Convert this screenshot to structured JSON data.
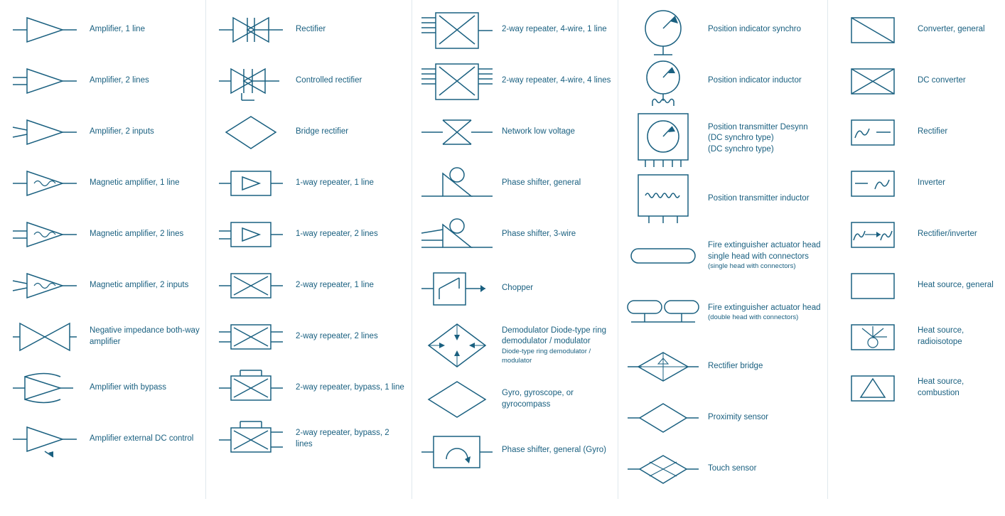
{
  "columns": [
    {
      "items": [
        {
          "label": "Amplifier, 1 line",
          "symbol": "amp1"
        },
        {
          "label": "Amplifier, 2 lines",
          "symbol": "amp2"
        },
        {
          "label": "Amplifier, 2 inputs",
          "symbol": "amp2in"
        },
        {
          "label": "Magnetic amplifier, 1 line",
          "symbol": "magamp1"
        },
        {
          "label": "Magnetic amplifier, 2 lines",
          "symbol": "magamp2"
        },
        {
          "label": "Magnetic amplifier, 2 inputs",
          "symbol": "magamp2in"
        },
        {
          "label": "Negative impedance both-way amplifier",
          "symbol": "negimpamp"
        },
        {
          "label": "Amplifier with bypass",
          "symbol": "ampbypass"
        },
        {
          "label": "Amplifier external DC control",
          "symbol": "ampdc"
        }
      ]
    },
    {
      "items": [
        {
          "label": "Rectifier",
          "symbol": "rect"
        },
        {
          "label": "Controlled rectifier",
          "symbol": "contrect"
        },
        {
          "label": "Bridge rectifier",
          "symbol": "bridgerect"
        },
        {
          "label": "1-way repeater, 1 line",
          "symbol": "rep1w1l"
        },
        {
          "label": "1-way repeater, 2 lines",
          "symbol": "rep1w2l"
        },
        {
          "label": "2-way repeater, 1 line",
          "symbol": "rep2w1l"
        },
        {
          "label": "2-way repeater, 2 lines",
          "symbol": "rep2w2l"
        },
        {
          "label": "2-way repeater, bypass, 1 line",
          "symbol": "rep2wbp1"
        },
        {
          "label": "2-way repeater, bypass, 2 lines",
          "symbol": "rep2wbp2"
        }
      ]
    },
    {
      "items": [
        {
          "label": "2-way repeater, 4-wire, 1 line",
          "symbol": "rep4w1l"
        },
        {
          "label": "2-way repeater, 4-wire, 4 lines",
          "symbol": "rep4w4l"
        },
        {
          "label": "Network low voltage",
          "symbol": "netlv"
        },
        {
          "label": "Phase shifter, general",
          "symbol": "phasegen"
        },
        {
          "label": "Phase shifter, 3-wire",
          "symbol": "phase3w"
        },
        {
          "label": "Chopper",
          "symbol": "chopper"
        },
        {
          "label": "Demodulator\nDiode-type ring demodulator / modulator",
          "symbol": "demod",
          "sublabel": "Diode-type ring demodulator / modulator"
        },
        {
          "label": "Gyro, gyroscope, or gyrocompass",
          "symbol": "gyro"
        },
        {
          "label": "Phase shifter, general (Gyro)",
          "symbol": "phasegyro"
        }
      ]
    },
    {
      "items": [
        {
          "label": "Position indicator synchro",
          "symbol": "posind"
        },
        {
          "label": "Position indicator inductor",
          "symbol": "posindinduct"
        },
        {
          "label": "Position transmitter Desynn (DC synchro type)",
          "symbol": "postransdesynn"
        },
        {
          "label": "Position transmitter inductor",
          "symbol": "postransinduct"
        },
        {
          "label": "Fire extinguisher actuator head\nsingle head with connectors",
          "symbol": "fire1",
          "sublabel": "(single head with connectors)"
        },
        {
          "label": "Fire extinguisher actuator head\ndouble head with connectors",
          "symbol": "fire2",
          "sublabel": "(double head with connectors)"
        },
        {
          "label": "Rectifier bridge",
          "symbol": "rectbridge"
        },
        {
          "label": "Proximity sensor",
          "symbol": "proxsensor"
        },
        {
          "label": "Touch sensor",
          "symbol": "touchsensor"
        }
      ]
    },
    {
      "items": [
        {
          "label": "Converter, general",
          "symbol": "convgen"
        },
        {
          "label": "DC converter",
          "symbol": "dcconv"
        },
        {
          "label": "Rectifier",
          "symbol": "rect2"
        },
        {
          "label": "Inverter",
          "symbol": "inverter"
        },
        {
          "label": "Rectifier/inverter",
          "symbol": "rectinv"
        },
        {
          "label": "Heat source, general",
          "symbol": "heatgen"
        },
        {
          "label": "Heat source, radioisotope",
          "symbol": "heatradio"
        },
        {
          "label": "Heat source, combustion",
          "symbol": "heatcomb"
        }
      ]
    }
  ]
}
